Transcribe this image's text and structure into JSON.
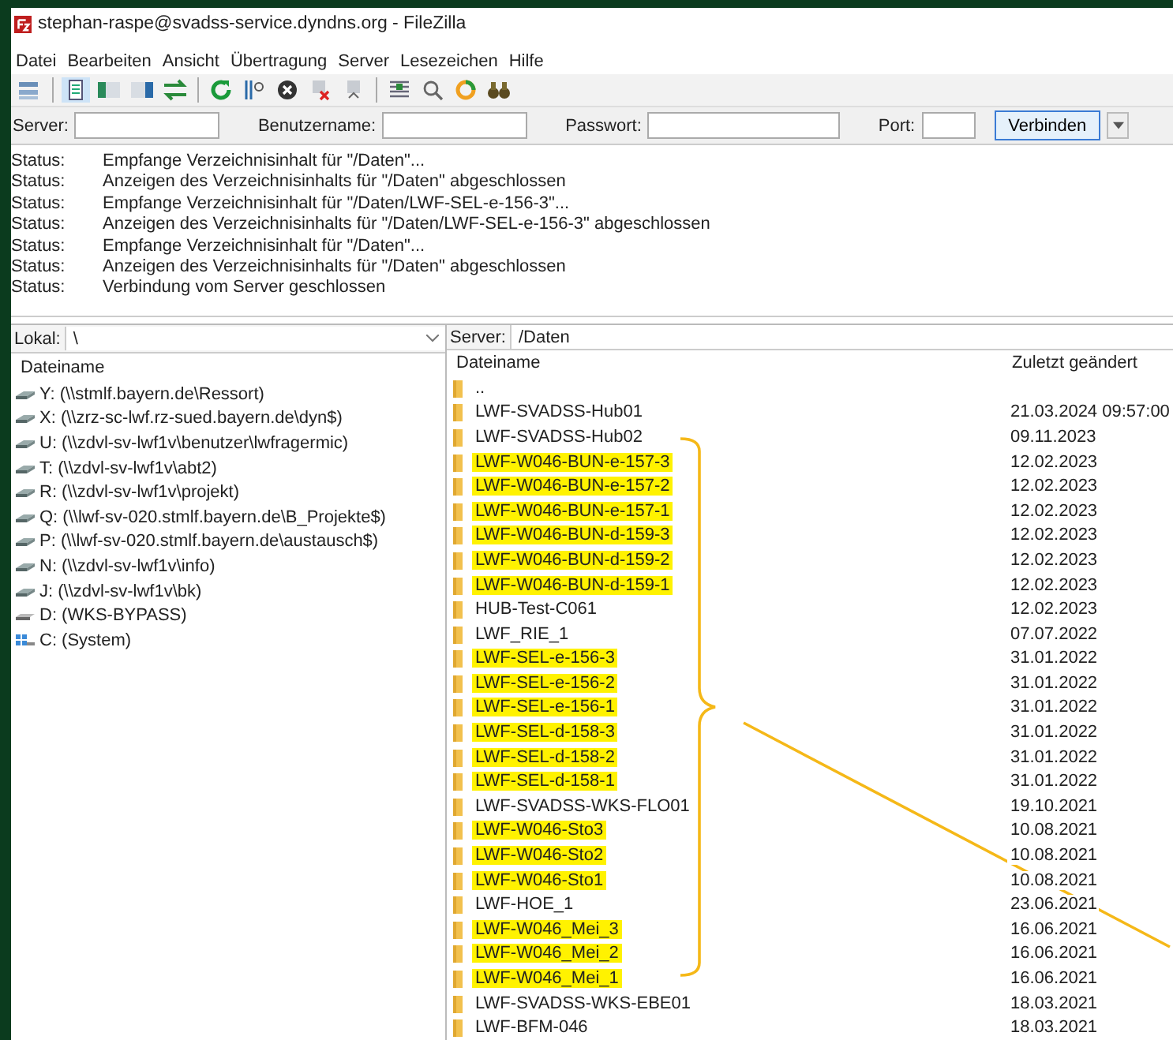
{
  "window": {
    "title": "stephan-raspe@svadss-service.dyndns.org - FileZilla"
  },
  "menu": [
    "Datei",
    "Bearbeiten",
    "Ansicht",
    "Übertragung",
    "Server",
    "Lesezeichen",
    "Hilfe"
  ],
  "quickconnect": {
    "server_label": "Server:",
    "user_label": "Benutzername:",
    "password_label": "Passwort:",
    "port_label": "Port:",
    "connect_button": "Verbinden"
  },
  "log": [
    {
      "label": "Status:",
      "message": "Empfange Verzeichnisinhalt für \"/Daten\"..."
    },
    {
      "label": "Status:",
      "message": "Anzeigen des Verzeichnisinhalts für \"/Daten\" abgeschlossen"
    },
    {
      "label": "Status:",
      "message": "Empfange Verzeichnisinhalt für \"/Daten/LWF-SEL-e-156-3\"..."
    },
    {
      "label": "Status:",
      "message": "Anzeigen des Verzeichnisinhalts für \"/Daten/LWF-SEL-e-156-3\" abgeschlossen"
    },
    {
      "label": "Status:",
      "message": "Empfange Verzeichnisinhalt für \"/Daten\"..."
    },
    {
      "label": "Status:",
      "message": "Anzeigen des Verzeichnisinhalts für \"/Daten\" abgeschlossen"
    },
    {
      "label": "Status:",
      "message": "Verbindung vom Server geschlossen"
    }
  ],
  "local": {
    "path_label": "Lokal:",
    "path": "\\",
    "column": "Dateiname",
    "items": [
      {
        "name": "Y: (\\\\stmlf.bayern.de\\Ressort)",
        "kind": "network"
      },
      {
        "name": "X: (\\\\zrz-sc-lwf.rz-sued.bayern.de\\dyn$)",
        "kind": "network"
      },
      {
        "name": "U: (\\\\zdvl-sv-lwf1v\\benutzer\\lwfragermic)",
        "kind": "network"
      },
      {
        "name": "T: (\\\\zdvl-sv-lwf1v\\abt2)",
        "kind": "network"
      },
      {
        "name": "R: (\\\\zdvl-sv-lwf1v\\projekt)",
        "kind": "network"
      },
      {
        "name": "Q: (\\\\lwf-sv-020.stmlf.bayern.de\\B_Projekte$)",
        "kind": "network"
      },
      {
        "name": "P: (\\\\lwf-sv-020.stmlf.bayern.de\\austausch$)",
        "kind": "network"
      },
      {
        "name": "N: (\\\\zdvl-sv-lwf1v\\info)",
        "kind": "network"
      },
      {
        "name": "J: (\\\\zdvl-sv-lwf1v\\bk)",
        "kind": "network"
      },
      {
        "name": "D: (WKS-BYPASS)",
        "kind": "local"
      },
      {
        "name": "C: (System)",
        "kind": "system"
      }
    ]
  },
  "remote": {
    "path_label": "Server:",
    "path": "/Daten",
    "columns": [
      "Dateiname",
      "Zuletzt geändert"
    ],
    "rows": [
      {
        "name": "..",
        "modified": "",
        "highlighted": false
      },
      {
        "name": "LWF-SVADSS-Hub01",
        "modified": "21.03.2024 09:57:00",
        "highlighted": false
      },
      {
        "name": "LWF-SVADSS-Hub02",
        "modified": "09.11.2023",
        "highlighted": false
      },
      {
        "name": "LWF-W046-BUN-e-157-3",
        "modified": "12.02.2023",
        "highlighted": true
      },
      {
        "name": "LWF-W046-BUN-e-157-2",
        "modified": "12.02.2023",
        "highlighted": true
      },
      {
        "name": "LWF-W046-BUN-e-157-1",
        "modified": "12.02.2023",
        "highlighted": true
      },
      {
        "name": "LWF-W046-BUN-d-159-3",
        "modified": "12.02.2023",
        "highlighted": true
      },
      {
        "name": "LWF-W046-BUN-d-159-2",
        "modified": "12.02.2023",
        "highlighted": true
      },
      {
        "name": "LWF-W046-BUN-d-159-1",
        "modified": "12.02.2023",
        "highlighted": true
      },
      {
        "name": "HUB-Test-C061",
        "modified": "12.02.2023",
        "highlighted": false
      },
      {
        "name": "LWF_RIE_1",
        "modified": "07.07.2022",
        "highlighted": false
      },
      {
        "name": "LWF-SEL-e-156-3",
        "modified": "31.01.2022",
        "highlighted": true
      },
      {
        "name": "LWF-SEL-e-156-2",
        "modified": "31.01.2022",
        "highlighted": true
      },
      {
        "name": "LWF-SEL-e-156-1",
        "modified": "31.01.2022",
        "highlighted": true
      },
      {
        "name": "LWF-SEL-d-158-3",
        "modified": "31.01.2022",
        "highlighted": true
      },
      {
        "name": "LWF-SEL-d-158-2",
        "modified": "31.01.2022",
        "highlighted": true
      },
      {
        "name": "LWF-SEL-d-158-1",
        "modified": "31.01.2022",
        "highlighted": true
      },
      {
        "name": "LWF-SVADSS-WKS-FLO01",
        "modified": "19.10.2021",
        "highlighted": false
      },
      {
        "name": "LWF-W046-Sto3",
        "modified": "10.08.2021",
        "highlighted": true
      },
      {
        "name": "LWF-W046-Sto2",
        "modified": "10.08.2021",
        "highlighted": true
      },
      {
        "name": "LWF-W046-Sto1",
        "modified": "10.08.2021",
        "highlighted": true
      },
      {
        "name": "LWF-HOE_1",
        "modified": "23.06.2021",
        "highlighted": false
      },
      {
        "name": "LWF-W046_Mei_3",
        "modified": "16.06.2021",
        "highlighted": true
      },
      {
        "name": "LWF-W046_Mei_2",
        "modified": "16.06.2021",
        "highlighted": true
      },
      {
        "name": "LWF-W046_Mei_1",
        "modified": "16.06.2021",
        "highlighted": true
      },
      {
        "name": "LWF-SVADSS-WKS-EBE01",
        "modified": "18.03.2021",
        "highlighted": false
      },
      {
        "name": "LWF-BFM-046",
        "modified": "18.03.2021",
        "highlighted": false
      }
    ]
  }
}
